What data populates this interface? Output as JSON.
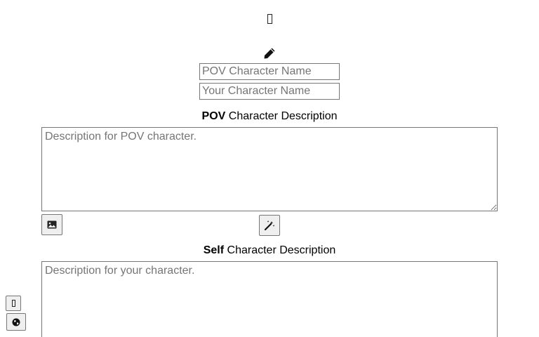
{
  "header": {
    "top_icon": "missing-glyph-icon",
    "pencil_icon": "pencil-icon"
  },
  "names": {
    "pov_placeholder": "POV Character Name",
    "pov_value": "",
    "self_placeholder": "Your Character Name",
    "self_value": ""
  },
  "pov_section": {
    "label_bold": "POV",
    "label_rest": " Character Description",
    "placeholder": "Description for POV character.",
    "value": "",
    "image_button_icon": "image-icon",
    "magic_button_icon": "magic-wand-icon"
  },
  "self_section": {
    "label_bold": "Self",
    "label_rest": " Character Description",
    "placeholder": "Description for your character.",
    "value": ""
  },
  "side_buttons": {
    "first_icon": "missing-glyph-icon",
    "second_icon": "globe-icon"
  }
}
